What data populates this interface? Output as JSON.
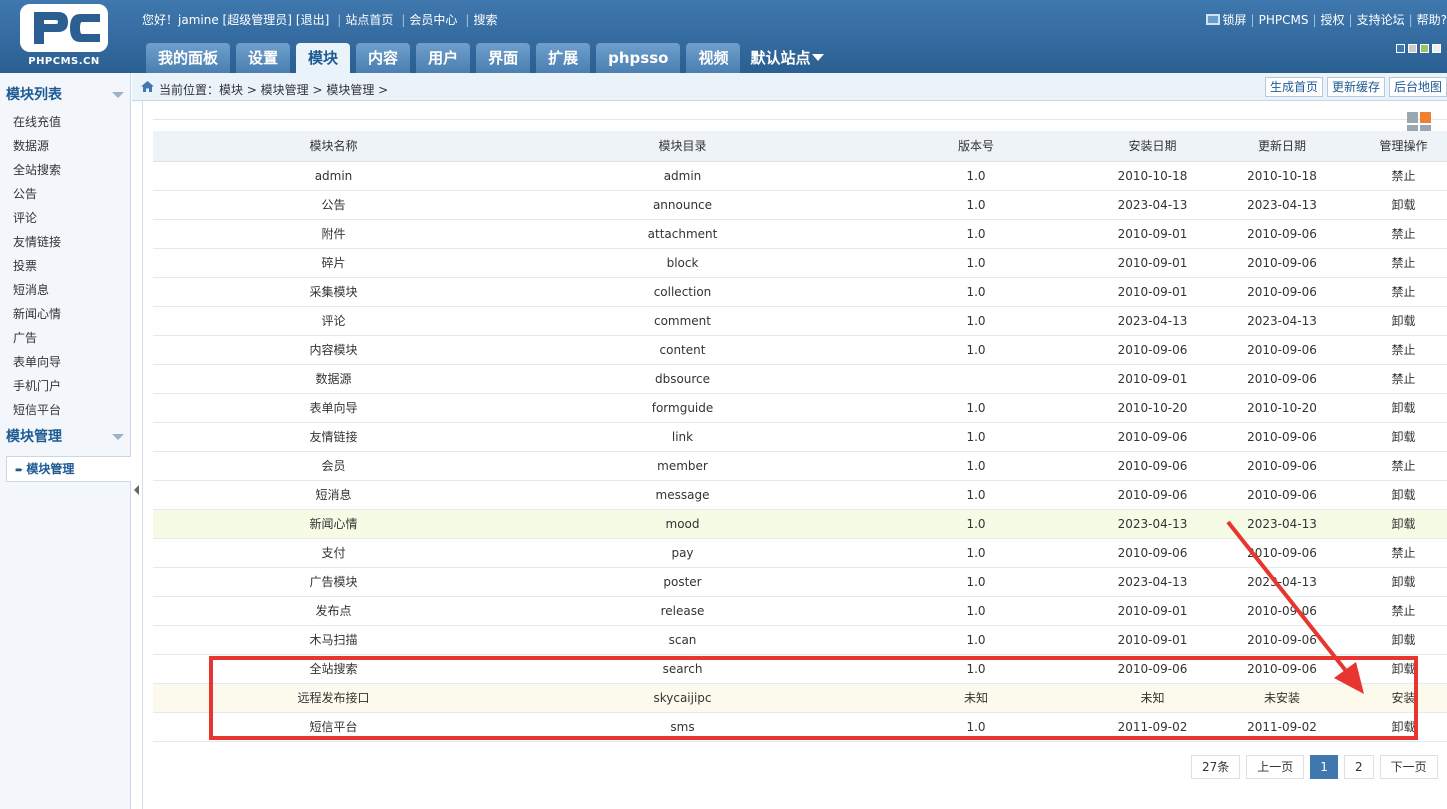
{
  "logo": {
    "text": "PHPCMS.CN"
  },
  "userbar": {
    "greeting": "您好！jamine [超级管理员]",
    "logout": "[退出]",
    "home": "站点首页",
    "member_center": "会员中心",
    "search": "搜索"
  },
  "rightbar": {
    "lock": "锁屏",
    "brand": "PHPCMS",
    "license": "授权",
    "forum": "支持论坛",
    "help": "帮助?"
  },
  "colors": {
    "accent": "#3f78ae",
    "active_tab_bg": "#eaf2fa",
    "uninstall": "#cc0000",
    "install": "#008800",
    "disabled": "#999999",
    "highlight": "#e8352f"
  },
  "nav": {
    "tabs": [
      "我的面板",
      "设置",
      "模块",
      "内容",
      "用户",
      "界面",
      "扩展",
      "phpsso",
      "视频"
    ],
    "active": "模块",
    "site_selector": "默认站点"
  },
  "sidebar": {
    "section1_title": "模块列表",
    "items": [
      "在线充值",
      "数据源",
      "全站搜索",
      "公告",
      "评论",
      "友情链接",
      "投票",
      "短消息",
      "新闻心情",
      "广告",
      "表单向导",
      "手机门户",
      "短信平台"
    ],
    "section2_title": "模块管理",
    "active_item": "模块管理"
  },
  "breadcrumb": {
    "text": "当前位置：模块 > 模块管理 > 模块管理 >"
  },
  "crumb_buttons": [
    "生成首页",
    "更新缓存",
    "后台地图"
  ],
  "table": {
    "headers": [
      "模块名称",
      "模块目录",
      "版本号",
      "安装日期",
      "更新日期",
      "管理操作"
    ],
    "rows": [
      [
        "admin",
        "admin",
        "1.0",
        "2010-10-18",
        "2010-10-18",
        "禁止"
      ],
      [
        "公告",
        "announce",
        "1.0",
        "2023-04-13",
        "2023-04-13",
        "卸载"
      ],
      [
        "附件",
        "attachment",
        "1.0",
        "2010-09-01",
        "2010-09-06",
        "禁止"
      ],
      [
        "碎片",
        "block",
        "1.0",
        "2010-09-01",
        "2010-09-06",
        "禁止"
      ],
      [
        "采集模块",
        "collection",
        "1.0",
        "2010-09-01",
        "2010-09-06",
        "禁止"
      ],
      [
        "评论",
        "comment",
        "1.0",
        "2023-04-13",
        "2023-04-13",
        "卸载"
      ],
      [
        "内容模块",
        "content",
        "1.0",
        "2010-09-06",
        "2010-09-06",
        "禁止"
      ],
      [
        "数据源",
        "dbsource",
        "",
        "2010-09-01",
        "2010-09-06",
        "禁止"
      ],
      [
        "表单向导",
        "formguide",
        "1.0",
        "2010-10-20",
        "2010-10-20",
        "卸载"
      ],
      [
        "友情链接",
        "link",
        "1.0",
        "2010-09-06",
        "2010-09-06",
        "卸载"
      ],
      [
        "会员",
        "member",
        "1.0",
        "2010-09-06",
        "2010-09-06",
        "禁止"
      ],
      [
        "短消息",
        "message",
        "1.0",
        "2010-09-06",
        "2010-09-06",
        "卸载"
      ],
      [
        "新闻心情",
        "mood",
        "1.0",
        "2023-04-13",
        "2023-04-13",
        "卸载"
      ],
      [
        "支付",
        "pay",
        "1.0",
        "2010-09-06",
        "2010-09-06",
        "禁止"
      ],
      [
        "广告模块",
        "poster",
        "1.0",
        "2023-04-13",
        "2023-04-13",
        "卸载"
      ],
      [
        "发布点",
        "release",
        "1.0",
        "2010-09-01",
        "2010-09-06",
        "禁止"
      ],
      [
        "木马扫描",
        "scan",
        "1.0",
        "2010-09-01",
        "2010-09-06",
        "卸载"
      ],
      [
        "全站搜索",
        "search",
        "1.0",
        "2010-09-06",
        "2010-09-06",
        "卸载"
      ],
      [
        "远程发布接口",
        "skycaijipc",
        "未知",
        "未知",
        "未安装",
        "安装"
      ],
      [
        "短信平台",
        "sms",
        "1.0",
        "2011-09-02",
        "2011-09-02",
        "卸载"
      ]
    ]
  },
  "pagination": {
    "total": "27条",
    "prev": "上一页",
    "pages": [
      "1",
      "2"
    ],
    "current": "1",
    "next": "下一页"
  }
}
